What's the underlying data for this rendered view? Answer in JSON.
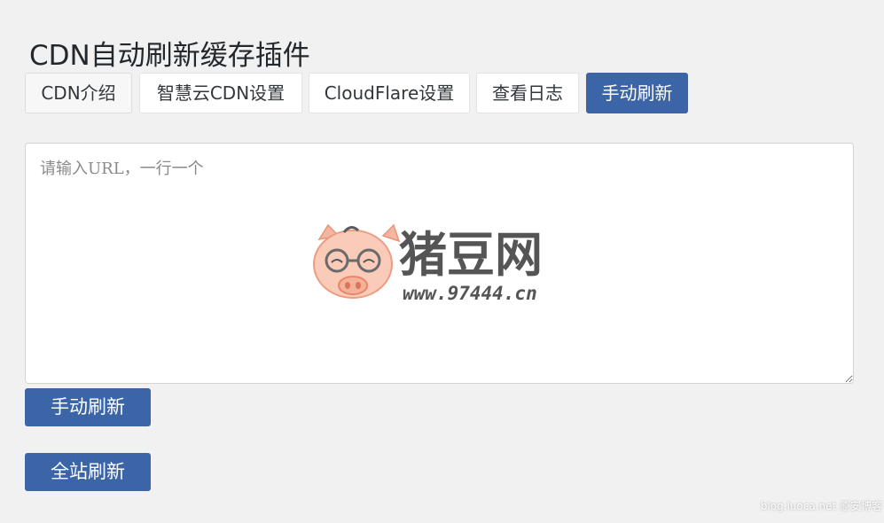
{
  "page": {
    "title": "CDN自动刷新缓存插件"
  },
  "tabs": [
    {
      "label": "CDN介绍",
      "active": false
    },
    {
      "label": "智慧云CDN设置",
      "active": false
    },
    {
      "label": "CloudFlare设置",
      "active": false
    },
    {
      "label": "查看日志",
      "active": false
    },
    {
      "label": "手动刷新",
      "active": true
    }
  ],
  "url_input": {
    "value": "",
    "placeholder": "请输入URL，一行一个"
  },
  "buttons": {
    "manual_refresh": "手动刷新",
    "full_refresh": "全站刷新"
  },
  "watermarks": {
    "logo_text": "猪豆网",
    "logo_url": "www.97444.cn",
    "corner": "blog.luoca.net 原安博客"
  },
  "colors": {
    "accent": "#3c65a8",
    "background": "#f1f1f1",
    "tab_background": "#ffffff"
  }
}
